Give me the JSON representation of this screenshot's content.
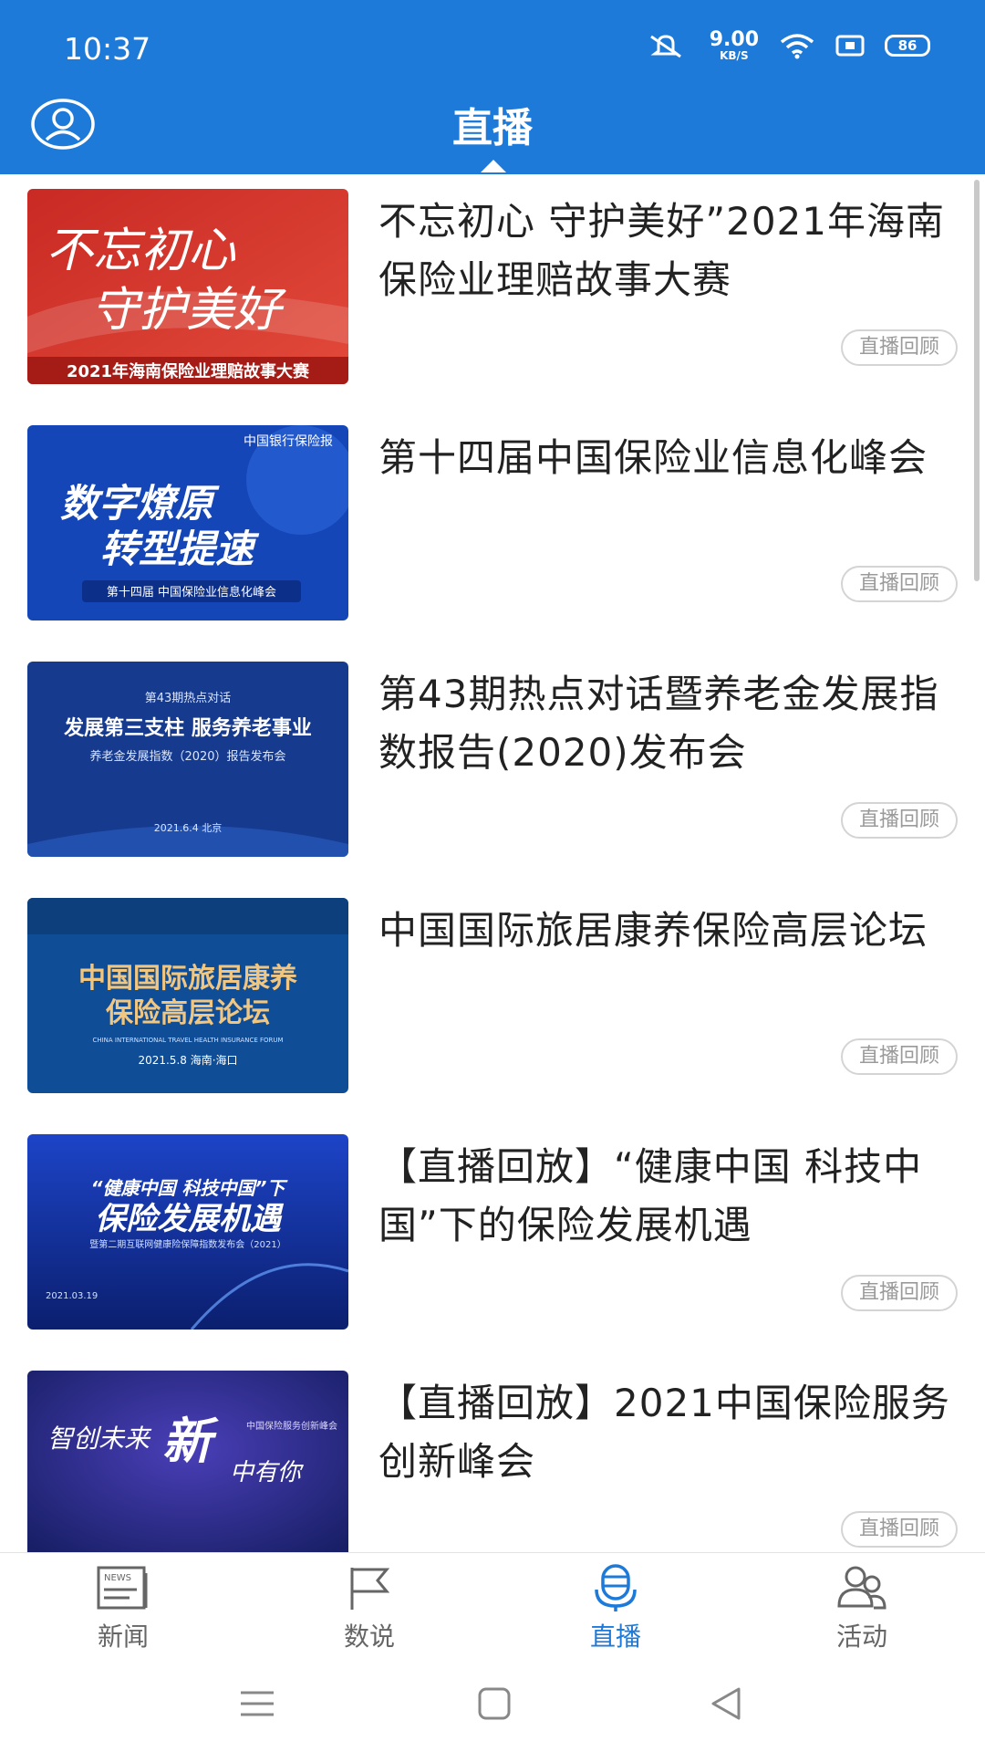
{
  "status_bar": {
    "time": "10:37",
    "net_speed": "9.00",
    "net_unit": "KB/S",
    "battery": "86"
  },
  "header": {
    "title": "直播"
  },
  "items": [
    {
      "title": "不忘初心 守护美好”2021年海南保险业理赔故事大赛",
      "badge": "直播回顾",
      "thumb_text_1": "不忘初心",
      "thumb_text_2": "守护美好",
      "thumb_text_3": "2021年海南保险业理赔故事大赛"
    },
    {
      "title": "第十四届中国保险业信息化峰会",
      "badge": "直播回顾",
      "thumb_text_1": "中国银行保险报",
      "thumb_text_2": "数字燎原",
      "thumb_text_3": "转型提速",
      "thumb_text_4": "第十四届 中国保险业信息化峰会"
    },
    {
      "title": "第43期热点对话暨养老金发展指数报告(2020)发布会",
      "badge": "直播回顾",
      "thumb_text_1": "第43期热点对话",
      "thumb_text_2": "发展第三支柱 服务养老事业",
      "thumb_text_3": "养老金发展指数（2020）报告发布会",
      "thumb_text_4": "2021.6.4 北京"
    },
    {
      "title": "中国国际旅居康养保险高层论坛",
      "badge": "直播回顾",
      "thumb_text_1": "中国国际旅居康养",
      "thumb_text_2": "保险高层论坛",
      "thumb_text_3": "CHINA INTERNATIONAL TRAVEL HEALTH INSURANCE FORUM",
      "thumb_text_4": "2021.5.8  海南·海口"
    },
    {
      "title": "【直播回放】“健康中国 科技中国”下的保险发展机遇",
      "badge": "直播回顾",
      "thumb_text_1": "“健康中国  科技中国”下",
      "thumb_text_2": "保险发展机遇",
      "thumb_text_3": "暨第二期互联网健康险保障指数发布会（2021）",
      "thumb_text_4": "2021.03.19"
    },
    {
      "title": "【直播回放】2021中国保险服务创新峰会",
      "badge": "直播回顾",
      "thumb_text_1": "智创未来",
      "thumb_text_2": "新",
      "thumb_text_3": "中有你",
      "thumb_text_4": "中国保险服务创新峰会"
    }
  ],
  "bottom_nav": [
    {
      "label": "新闻",
      "icon": "news-icon"
    },
    {
      "label": "数说",
      "icon": "flag-icon"
    },
    {
      "label": "直播",
      "icon": "microphone-icon",
      "active": true
    },
    {
      "label": "活动",
      "icon": "people-icon"
    }
  ],
  "colors": {
    "primary": "#1d7ad8",
    "badge_border": "#d4d4d4",
    "badge_text": "#9a9a9a"
  }
}
